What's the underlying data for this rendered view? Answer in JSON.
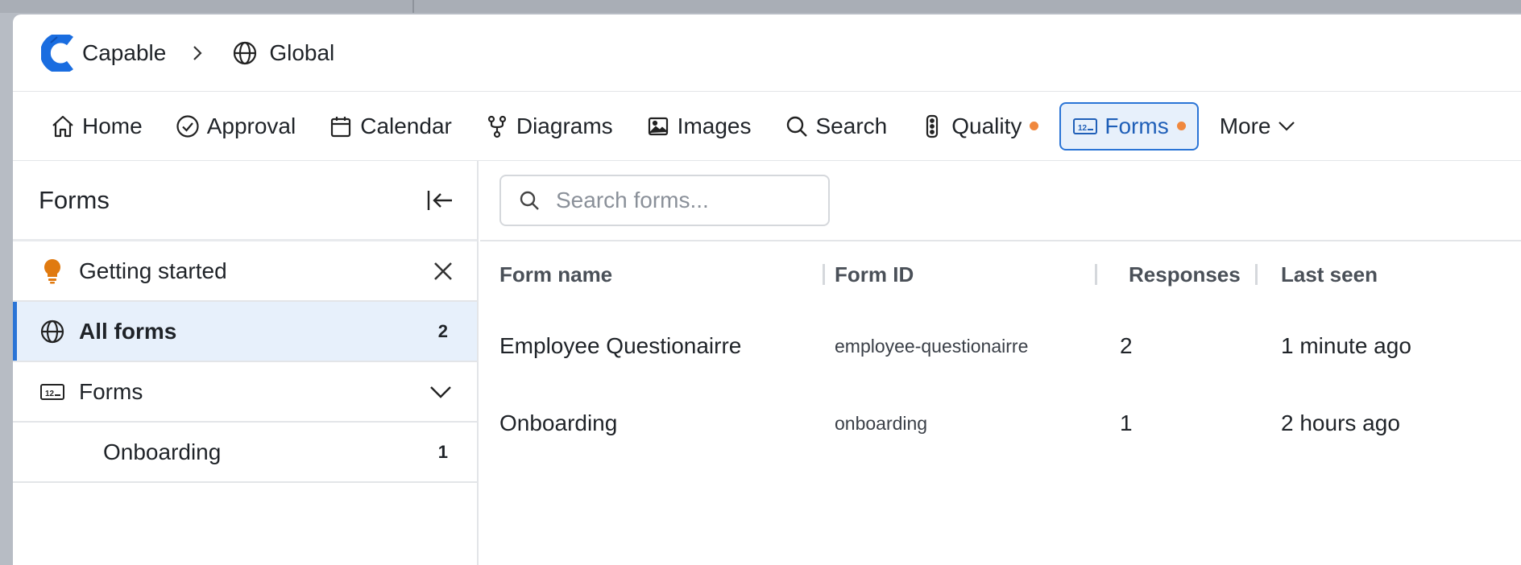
{
  "header": {
    "org_name": "Capable",
    "workspace": "Global"
  },
  "nav": {
    "items": [
      {
        "label": "Home",
        "icon": "home-icon"
      },
      {
        "label": "Approval",
        "icon": "check-circle-icon"
      },
      {
        "label": "Calendar",
        "icon": "calendar-icon"
      },
      {
        "label": "Diagrams",
        "icon": "diagram-icon"
      },
      {
        "label": "Images",
        "icon": "image-icon"
      },
      {
        "label": "Search",
        "icon": "search-icon"
      },
      {
        "label": "Quality",
        "icon": "traffic-light-icon"
      },
      {
        "label": "Forms",
        "icon": "forms-icon"
      },
      {
        "label": "More",
        "icon": "chevron-down-icon"
      }
    ],
    "active": "Forms"
  },
  "sidebar": {
    "title": "Forms",
    "getting_started": "Getting started",
    "all_forms": {
      "label": "All forms",
      "count": "2"
    },
    "forms_group": {
      "label": "Forms"
    },
    "sub_items": [
      {
        "label": "Onboarding",
        "count": "1"
      }
    ]
  },
  "main": {
    "search": {
      "placeholder": "Search forms..."
    },
    "columns": [
      "Form name",
      "Form ID",
      "Responses",
      "Last seen"
    ],
    "rows": [
      {
        "name": "Employee Questionairre",
        "id": "employee-questionairre",
        "responses": "2",
        "last_seen": "1 minute ago"
      },
      {
        "name": "Onboarding",
        "id": "onboarding",
        "responses": "1",
        "last_seen": "2 hours ago"
      }
    ]
  },
  "colors": {
    "accent": "#2a74d6",
    "active_bg": "#e7f0fb",
    "notify_dot": "#f0883e",
    "bulb": "#e07a10"
  }
}
